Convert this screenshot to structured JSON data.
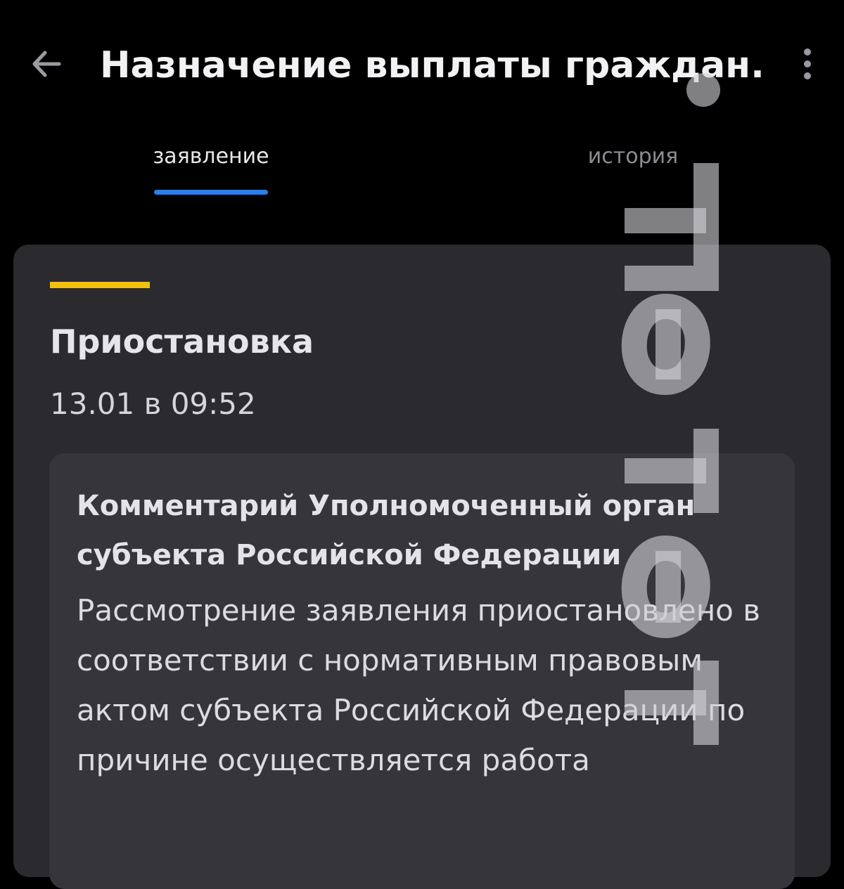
{
  "header": {
    "title": "Назначение выплаты граждан...",
    "back_icon": "arrow-left-icon",
    "menu_icon": "more-vertical-icon"
  },
  "tabs": [
    {
      "label": "заявление",
      "active": true
    },
    {
      "label": "история",
      "active": false
    }
  ],
  "status": {
    "title": "Приостановка",
    "date": "13.01 в 09:52",
    "accent_color": "#f2c10f"
  },
  "comment": {
    "title": "Комментарий Уполномоченный орган субъекта Российской Федерации",
    "text": "Рассмотрение заявления приостановлено в соответствии с нормативным правовым актом субъекта Российской Федерации по причине осуществляется работа"
  },
  "colors": {
    "background": "#000000",
    "card": "#2a2a2f",
    "tab_indicator": "#2c7ee6"
  },
  "watermark": {
    "text": "теле",
    "icon": "watermark-logo"
  }
}
